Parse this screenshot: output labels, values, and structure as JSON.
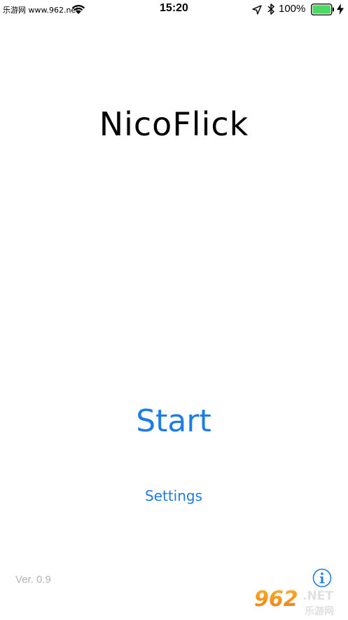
{
  "status_bar": {
    "carrier": "乐游网 www.962.net",
    "time": "15:20",
    "battery_percent": "100%",
    "battery_level": 1.0,
    "icons": [
      "wifi-icon",
      "location-icon",
      "bluetooth-icon",
      "battery-icon",
      "charging-icon"
    ]
  },
  "main": {
    "title": "NicoFlick",
    "start_label": "Start",
    "settings_label": "Settings"
  },
  "footer": {
    "version": "Ver. 0.9",
    "info_icon": "info-icon"
  },
  "watermark": {
    "brand_numerals": "962",
    "brand_suffix": ".NET",
    "brand_cn": "乐游网"
  },
  "colors": {
    "accent": "#1e7ce6",
    "battery": "#4cd964",
    "version_gray": "#b4b4b4"
  }
}
